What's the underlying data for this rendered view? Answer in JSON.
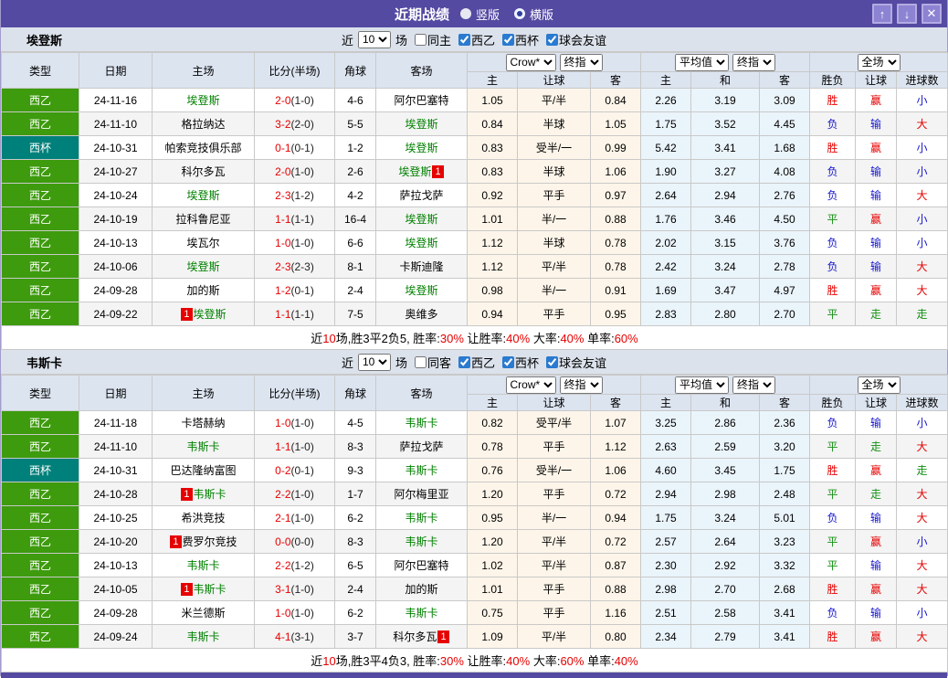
{
  "colors": {
    "accent_purple": "#544aa2",
    "league_green": "#3d9b0d",
    "league_teal": "#00807a",
    "team_green": "#008000",
    "score_red": "#e60000",
    "win_red": "#e60000",
    "draw_green": "#149114",
    "loss_blue": "#1515cc",
    "odds_bg_cream": "#fdf5e9",
    "odds_bg_blue": "#eaf4fb",
    "header_bg": "#dce4f0"
  },
  "titlebar": {
    "title": "近期战绩",
    "radios": [
      {
        "label": "竖版",
        "selected": true
      },
      {
        "label": "横版",
        "selected": false
      }
    ],
    "buttons": {
      "up": "↑",
      "down": "↓",
      "close": "✕"
    }
  },
  "result_colors": {
    "胜": "red",
    "平": "green",
    "负": "blue",
    "赢": "red",
    "输": "blue",
    "走": "green",
    "大": "red",
    "小": "blue"
  },
  "sections": [
    {
      "team": "埃登斯",
      "filter": {
        "prefix": "近",
        "count": "10",
        "suffix": "场",
        "same_label": "同主",
        "same_checked": false,
        "leagues": [
          {
            "label": "西乙",
            "checked": true
          },
          {
            "label": "西杯",
            "checked": true
          },
          {
            "label": "球会友谊",
            "checked": true
          }
        ]
      },
      "header": {
        "cols": [
          "类型",
          "日期",
          "主场",
          "比分(半场)",
          "角球",
          "客场"
        ],
        "odds_dropdowns": [
          "Crow*",
          "终指"
        ],
        "odds_cols": [
          "主",
          "让球",
          "客"
        ],
        "avg_dropdowns": [
          "平均值",
          "终指"
        ],
        "avg_cols": [
          "主",
          "和",
          "客"
        ],
        "result_dropdown": "全场",
        "result_cols": [
          "胜负",
          "让球",
          "进球数"
        ]
      },
      "rows": [
        {
          "league": "西乙",
          "league_color": "green",
          "date": "24-11-16",
          "home": {
            "name": "埃登斯",
            "highlight": true
          },
          "score_ft": "2-0",
          "score_ht": "(1-0)",
          "corners": "4-6",
          "away": {
            "name": "阿尔巴塞特",
            "highlight": false
          },
          "handicap_odds": [
            "1.05",
            "平/半",
            "0.84"
          ],
          "avg_odds": [
            "2.26",
            "3.19",
            "3.09"
          ],
          "results": [
            "胜",
            "赢",
            "小"
          ]
        },
        {
          "league": "西乙",
          "league_color": "green",
          "date": "24-11-10",
          "home": {
            "name": "格拉纳达",
            "highlight": false
          },
          "score_ft": "3-2",
          "score_ht": "(2-0)",
          "corners": "5-5",
          "away": {
            "name": "埃登斯",
            "highlight": true
          },
          "handicap_odds": [
            "0.84",
            "半球",
            "1.05"
          ],
          "avg_odds": [
            "1.75",
            "3.52",
            "4.45"
          ],
          "results": [
            "负",
            "输",
            "大"
          ]
        },
        {
          "league": "西杯",
          "league_color": "teal",
          "date": "24-10-31",
          "home": {
            "name": "帕索竞技俱乐部",
            "highlight": false
          },
          "score_ft": "0-1",
          "score_ht": "(0-1)",
          "corners": "1-2",
          "away": {
            "name": "埃登斯",
            "highlight": true
          },
          "handicap_odds": [
            "0.83",
            "受半/一",
            "0.99"
          ],
          "avg_odds": [
            "5.42",
            "3.41",
            "1.68"
          ],
          "results": [
            "胜",
            "赢",
            "小"
          ]
        },
        {
          "league": "西乙",
          "league_color": "green",
          "date": "24-10-27",
          "home": {
            "name": "科尔多瓦",
            "highlight": false
          },
          "score_ft": "2-0",
          "score_ht": "(1-0)",
          "corners": "2-6",
          "away": {
            "name": "埃登斯",
            "highlight": true,
            "badge": "1",
            "badge_pos": "after"
          },
          "handicap_odds": [
            "0.83",
            "半球",
            "1.06"
          ],
          "avg_odds": [
            "1.90",
            "3.27",
            "4.08"
          ],
          "results": [
            "负",
            "输",
            "小"
          ]
        },
        {
          "league": "西乙",
          "league_color": "green",
          "date": "24-10-24",
          "home": {
            "name": "埃登斯",
            "highlight": true
          },
          "score_ft": "2-3",
          "score_ht": "(1-2)",
          "corners": "4-2",
          "away": {
            "name": "萨拉戈萨",
            "highlight": false
          },
          "handicap_odds": [
            "0.92",
            "平手",
            "0.97"
          ],
          "avg_odds": [
            "2.64",
            "2.94",
            "2.76"
          ],
          "results": [
            "负",
            "输",
            "大"
          ]
        },
        {
          "league": "西乙",
          "league_color": "green",
          "date": "24-10-19",
          "home": {
            "name": "拉科鲁尼亚",
            "highlight": false
          },
          "score_ft": "1-1",
          "score_ht": "(1-1)",
          "corners": "16-4",
          "away": {
            "name": "埃登斯",
            "highlight": true
          },
          "handicap_odds": [
            "1.01",
            "半/一",
            "0.88"
          ],
          "avg_odds": [
            "1.76",
            "3.46",
            "4.50"
          ],
          "results": [
            "平",
            "赢",
            "小"
          ]
        },
        {
          "league": "西乙",
          "league_color": "green",
          "date": "24-10-13",
          "home": {
            "name": "埃瓦尔",
            "highlight": false
          },
          "score_ft": "1-0",
          "score_ht": "(1-0)",
          "corners": "6-6",
          "away": {
            "name": "埃登斯",
            "highlight": true
          },
          "handicap_odds": [
            "1.12",
            "半球",
            "0.78"
          ],
          "avg_odds": [
            "2.02",
            "3.15",
            "3.76"
          ],
          "results": [
            "负",
            "输",
            "小"
          ]
        },
        {
          "league": "西乙",
          "league_color": "green",
          "date": "24-10-06",
          "home": {
            "name": "埃登斯",
            "highlight": true
          },
          "score_ft": "2-3",
          "score_ht": "(2-3)",
          "corners": "8-1",
          "away": {
            "name": "卡斯迪隆",
            "highlight": false
          },
          "handicap_odds": [
            "1.12",
            "平/半",
            "0.78"
          ],
          "avg_odds": [
            "2.42",
            "3.24",
            "2.78"
          ],
          "results": [
            "负",
            "输",
            "大"
          ]
        },
        {
          "league": "西乙",
          "league_color": "green",
          "date": "24-09-28",
          "home": {
            "name": "加的斯",
            "highlight": false
          },
          "score_ft": "1-2",
          "score_ht": "(0-1)",
          "corners": "2-4",
          "away": {
            "name": "埃登斯",
            "highlight": true
          },
          "handicap_odds": [
            "0.98",
            "半/一",
            "0.91"
          ],
          "avg_odds": [
            "1.69",
            "3.47",
            "4.97"
          ],
          "results": [
            "胜",
            "赢",
            "大"
          ]
        },
        {
          "league": "西乙",
          "league_color": "green",
          "date": "24-09-22",
          "home": {
            "name": "埃登斯",
            "highlight": true,
            "badge": "1",
            "badge_pos": "before"
          },
          "score_ft": "1-1",
          "score_ht": "(1-1)",
          "corners": "7-5",
          "away": {
            "name": "奥维多",
            "highlight": false
          },
          "handicap_odds": [
            "0.94",
            "平手",
            "0.95"
          ],
          "avg_odds": [
            "2.83",
            "2.80",
            "2.70"
          ],
          "results": [
            "平",
            "走",
            "走"
          ]
        }
      ],
      "summary": [
        {
          "text": "近"
        },
        {
          "text": "10",
          "red": true
        },
        {
          "text": "场,胜3平2负5, 胜率:"
        },
        {
          "text": "30%",
          "red": true
        },
        {
          "text": " 让胜率:"
        },
        {
          "text": "40%",
          "red": true
        },
        {
          "text": " 大率:"
        },
        {
          "text": "40%",
          "red": true
        },
        {
          "text": " 单率:"
        },
        {
          "text": "60%",
          "red": true
        }
      ]
    },
    {
      "team": "韦斯卡",
      "filter": {
        "prefix": "近",
        "count": "10",
        "suffix": "场",
        "same_label": "同客",
        "same_checked": false,
        "leagues": [
          {
            "label": "西乙",
            "checked": true
          },
          {
            "label": "西杯",
            "checked": true
          },
          {
            "label": "球会友谊",
            "checked": true
          }
        ]
      },
      "header": {
        "cols": [
          "类型",
          "日期",
          "主场",
          "比分(半场)",
          "角球",
          "客场"
        ],
        "odds_dropdowns": [
          "Crow*",
          "终指"
        ],
        "odds_cols": [
          "主",
          "让球",
          "客"
        ],
        "avg_dropdowns": [
          "平均值",
          "终指"
        ],
        "avg_cols": [
          "主",
          "和",
          "客"
        ],
        "result_dropdown": "全场",
        "result_cols": [
          "胜负",
          "让球",
          "进球数"
        ]
      },
      "rows": [
        {
          "league": "西乙",
          "league_color": "green",
          "date": "24-11-18",
          "home": {
            "name": "卡塔赫纳",
            "highlight": false
          },
          "score_ft": "1-0",
          "score_ht": "(1-0)",
          "corners": "4-5",
          "away": {
            "name": "韦斯卡",
            "highlight": true
          },
          "handicap_odds": [
            "0.82",
            "受平/半",
            "1.07"
          ],
          "avg_odds": [
            "3.25",
            "2.86",
            "2.36"
          ],
          "results": [
            "负",
            "输",
            "小"
          ]
        },
        {
          "league": "西乙",
          "league_color": "green",
          "date": "24-11-10",
          "home": {
            "name": "韦斯卡",
            "highlight": true
          },
          "score_ft": "1-1",
          "score_ht": "(1-0)",
          "corners": "8-3",
          "away": {
            "name": "萨拉戈萨",
            "highlight": false
          },
          "handicap_odds": [
            "0.78",
            "平手",
            "1.12"
          ],
          "avg_odds": [
            "2.63",
            "2.59",
            "3.20"
          ],
          "results": [
            "平",
            "走",
            "大"
          ]
        },
        {
          "league": "西杯",
          "league_color": "teal",
          "date": "24-10-31",
          "home": {
            "name": "巴达隆纳富图",
            "highlight": false
          },
          "score_ft": "0-2",
          "score_ht": "(0-1)",
          "corners": "9-3",
          "away": {
            "name": "韦斯卡",
            "highlight": true
          },
          "handicap_odds": [
            "0.76",
            "受半/一",
            "1.06"
          ],
          "avg_odds": [
            "4.60",
            "3.45",
            "1.75"
          ],
          "results": [
            "胜",
            "赢",
            "走"
          ]
        },
        {
          "league": "西乙",
          "league_color": "green",
          "date": "24-10-28",
          "home": {
            "name": "韦斯卡",
            "highlight": true,
            "badge": "1",
            "badge_pos": "before"
          },
          "score_ft": "2-2",
          "score_ht": "(1-0)",
          "corners": "1-7",
          "away": {
            "name": "阿尔梅里亚",
            "highlight": false
          },
          "handicap_odds": [
            "1.20",
            "平手",
            "0.72"
          ],
          "avg_odds": [
            "2.94",
            "2.98",
            "2.48"
          ],
          "results": [
            "平",
            "走",
            "大"
          ]
        },
        {
          "league": "西乙",
          "league_color": "green",
          "date": "24-10-25",
          "home": {
            "name": "希洪竞技",
            "highlight": false
          },
          "score_ft": "2-1",
          "score_ht": "(1-0)",
          "corners": "6-2",
          "away": {
            "name": "韦斯卡",
            "highlight": true
          },
          "handicap_odds": [
            "0.95",
            "半/一",
            "0.94"
          ],
          "avg_odds": [
            "1.75",
            "3.24",
            "5.01"
          ],
          "results": [
            "负",
            "输",
            "大"
          ]
        },
        {
          "league": "西乙",
          "league_color": "green",
          "date": "24-10-20",
          "home": {
            "name": "费罗尔竞技",
            "highlight": false,
            "badge": "1",
            "badge_pos": "before"
          },
          "score_ft": "0-0",
          "score_ht": "(0-0)",
          "corners": "8-3",
          "away": {
            "name": "韦斯卡",
            "highlight": true
          },
          "handicap_odds": [
            "1.20",
            "平/半",
            "0.72"
          ],
          "avg_odds": [
            "2.57",
            "2.64",
            "3.23"
          ],
          "results": [
            "平",
            "赢",
            "小"
          ]
        },
        {
          "league": "西乙",
          "league_color": "green",
          "date": "24-10-13",
          "home": {
            "name": "韦斯卡",
            "highlight": true
          },
          "score_ft": "2-2",
          "score_ht": "(1-2)",
          "corners": "6-5",
          "away": {
            "name": "阿尔巴塞特",
            "highlight": false
          },
          "handicap_odds": [
            "1.02",
            "平/半",
            "0.87"
          ],
          "avg_odds": [
            "2.30",
            "2.92",
            "3.32"
          ],
          "results": [
            "平",
            "输",
            "大"
          ]
        },
        {
          "league": "西乙",
          "league_color": "green",
          "date": "24-10-05",
          "home": {
            "name": "韦斯卡",
            "highlight": true,
            "badge": "1",
            "badge_pos": "before"
          },
          "score_ft": "3-1",
          "score_ht": "(1-0)",
          "corners": "2-4",
          "away": {
            "name": "加的斯",
            "highlight": false
          },
          "handicap_odds": [
            "1.01",
            "平手",
            "0.88"
          ],
          "avg_odds": [
            "2.98",
            "2.70",
            "2.68"
          ],
          "results": [
            "胜",
            "赢",
            "大"
          ]
        },
        {
          "league": "西乙",
          "league_color": "green",
          "date": "24-09-28",
          "home": {
            "name": "米兰德斯",
            "highlight": false
          },
          "score_ft": "1-0",
          "score_ht": "(1-0)",
          "corners": "6-2",
          "away": {
            "name": "韦斯卡",
            "highlight": true
          },
          "handicap_odds": [
            "0.75",
            "平手",
            "1.16"
          ],
          "avg_odds": [
            "2.51",
            "2.58",
            "3.41"
          ],
          "results": [
            "负",
            "输",
            "小"
          ]
        },
        {
          "league": "西乙",
          "league_color": "green",
          "date": "24-09-24",
          "home": {
            "name": "韦斯卡",
            "highlight": true
          },
          "score_ft": "4-1",
          "score_ht": "(3-1)",
          "corners": "3-7",
          "away": {
            "name": "科尔多瓦",
            "highlight": false,
            "badge": "1",
            "badge_pos": "after"
          },
          "handicap_odds": [
            "1.09",
            "平/半",
            "0.80"
          ],
          "avg_odds": [
            "2.34",
            "2.79",
            "3.41"
          ],
          "results": [
            "胜",
            "赢",
            "大"
          ]
        }
      ],
      "summary": [
        {
          "text": "近"
        },
        {
          "text": "10",
          "red": true
        },
        {
          "text": "场,胜3平4负3, 胜率:"
        },
        {
          "text": "30%",
          "red": true
        },
        {
          "text": " 让胜率:"
        },
        {
          "text": "40%",
          "red": true
        },
        {
          "text": " 大率:"
        },
        {
          "text": "60%",
          "red": true
        },
        {
          "text": " 单率:"
        },
        {
          "text": "40%",
          "red": true
        }
      ]
    }
  ]
}
